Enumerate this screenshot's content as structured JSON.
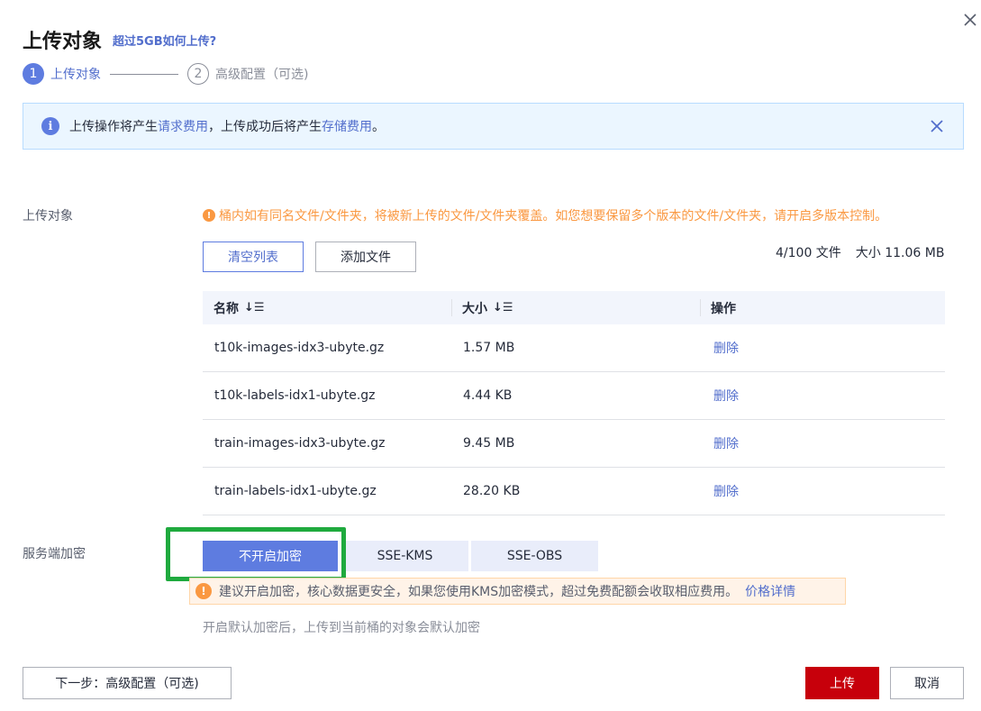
{
  "header": {
    "title": "上传对象",
    "help_link": "超过5GB如何上传?"
  },
  "steps": [
    {
      "number": "1",
      "label": "上传对象",
      "active": true
    },
    {
      "number": "2",
      "label": "高级配置（可选)",
      "active": false
    }
  ],
  "info_bar": {
    "prefix": "上传操作将产生",
    "link1": "请求费用",
    "middle": "，上传成功后将产生",
    "link2": "存储费用",
    "suffix": "。"
  },
  "upload_section": {
    "label": "上传对象",
    "warning": "桶内如有同名文件/文件夹，将被新上传的文件/文件夹覆盖。如您想要保留多个版本的文件/文件夹，请开启多版本控制。",
    "clear_button": "清空列表",
    "add_button": "添加文件",
    "file_count": "4/100 文件",
    "total_size": "大小 11.06 MB"
  },
  "table": {
    "headers": {
      "name": "名称",
      "size": "大小",
      "action": "操作"
    },
    "sort_glyph": "↓☰",
    "rows": [
      {
        "name": "t10k-images-idx3-ubyte.gz",
        "size": "1.57 MB",
        "action": "删除"
      },
      {
        "name": "t10k-labels-idx1-ubyte.gz",
        "size": "4.44 KB",
        "action": "删除"
      },
      {
        "name": "train-images-idx3-ubyte.gz",
        "size": "9.45 MB",
        "action": "删除"
      },
      {
        "name": "train-labels-idx1-ubyte.gz",
        "size": "28.20 KB",
        "action": "删除"
      }
    ]
  },
  "encryption": {
    "label": "服务端加密",
    "options": [
      "不开启加密",
      "SSE-KMS",
      "SSE-OBS"
    ],
    "selected": "不开启加密",
    "tip": "建议开启加密，核心数据更安全，如果您使用KMS加密模式，超过免费配额会收取相应费用。",
    "tip_link": "价格详情",
    "hint": "开启默认加密后，上传到当前桶的对象会默认加密"
  },
  "footer": {
    "next_button": "下一步：高级配置（可选)",
    "upload_button": "上传",
    "cancel_button": "取消"
  },
  "colors": {
    "accent": "#5e7ce0",
    "link": "#526ecc",
    "danger": "#c7000b",
    "highlight": "#1faa3e",
    "warning": "#fa9841"
  }
}
